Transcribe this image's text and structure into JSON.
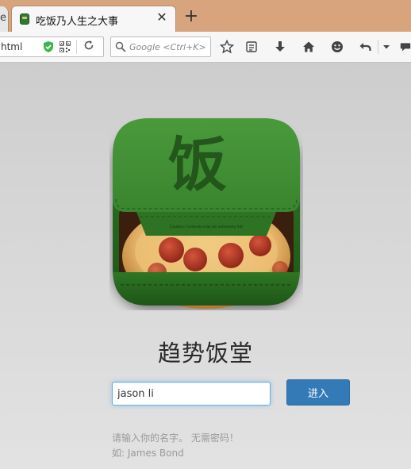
{
  "browser": {
    "prev_tab_fragment": "e",
    "tab_title": "吃饭乃人生之大事",
    "tab_close": "✕",
    "new_tab": "+",
    "url_fragment": "html",
    "search_placeholder": "Google <Ctrl+K>"
  },
  "app": {
    "icon_character": "饭",
    "box_fine_print": "Caution: Contents may be extremely hot",
    "name": "趋势饭堂"
  },
  "form": {
    "name_value": "jason li",
    "submit_label": "进入",
    "hint_line1": "请输入你的名字。 无需密码！",
    "hint_line2": "如: James Bond"
  },
  "colors": {
    "titlebar": "#d7a47e",
    "box_green": "#3a8a2e",
    "button_blue": "#337ab7",
    "input_focus": "#66afe9"
  }
}
